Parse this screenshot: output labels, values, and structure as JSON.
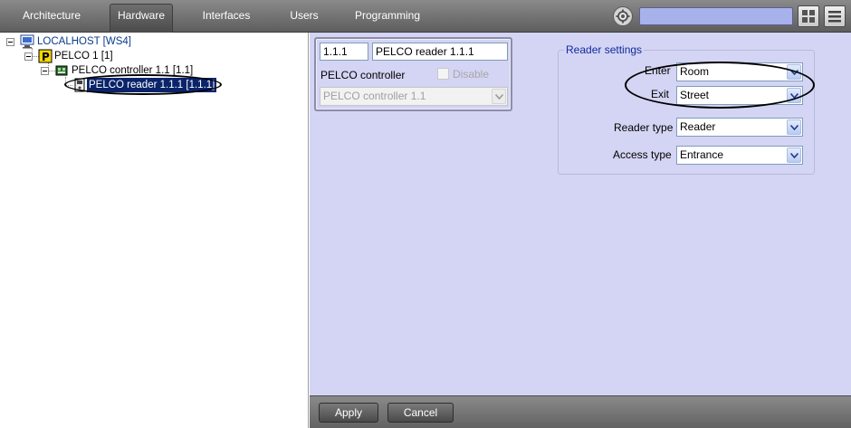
{
  "tabs": [
    {
      "label": "Architecture",
      "active": false
    },
    {
      "label": "Hardware",
      "active": true
    },
    {
      "label": "Interfaces",
      "active": false
    },
    {
      "label": "Users",
      "active": false
    },
    {
      "label": "Programming",
      "active": false
    }
  ],
  "toolbar": {
    "search_value": "",
    "icons": [
      "gear-icon",
      "grid-view-icon",
      "menu-icon"
    ]
  },
  "tree": {
    "nodes": [
      {
        "label": "LOCALHOST [WS4]",
        "icon": "computer-icon",
        "color": "#0b3b8c"
      },
      {
        "label": "PELCO 1 [1]",
        "icon": "pelco-icon"
      },
      {
        "label": "PELCO controller 1.1 [1.1]",
        "icon": "controller-icon"
      },
      {
        "label": "PELCO reader 1.1.1 [1.1.1]",
        "icon": "reader-icon",
        "selected": true
      }
    ]
  },
  "object": {
    "id": "1.1.1",
    "name": "PELCO reader 1.1.1",
    "parent_label": "PELCO controller",
    "disable_label": "Disable",
    "parent_value": "PELCO controller 1.1"
  },
  "reader_settings": {
    "title": "Reader settings",
    "enter_label": "Enter",
    "enter_value": "Room",
    "exit_label": "Exit",
    "exit_value": "Street",
    "reader_type_label": "Reader type",
    "reader_type_value": "Reader",
    "access_type_label": "Access type",
    "access_type_value": "Entrance"
  },
  "buttons": {
    "apply": "Apply",
    "cancel": "Cancel"
  },
  "colors": {
    "panel_bg": "#d4d4f4",
    "group_title": "#0f2c9c",
    "selection": "#0a246a",
    "search_bg": "#a7b1ea"
  }
}
